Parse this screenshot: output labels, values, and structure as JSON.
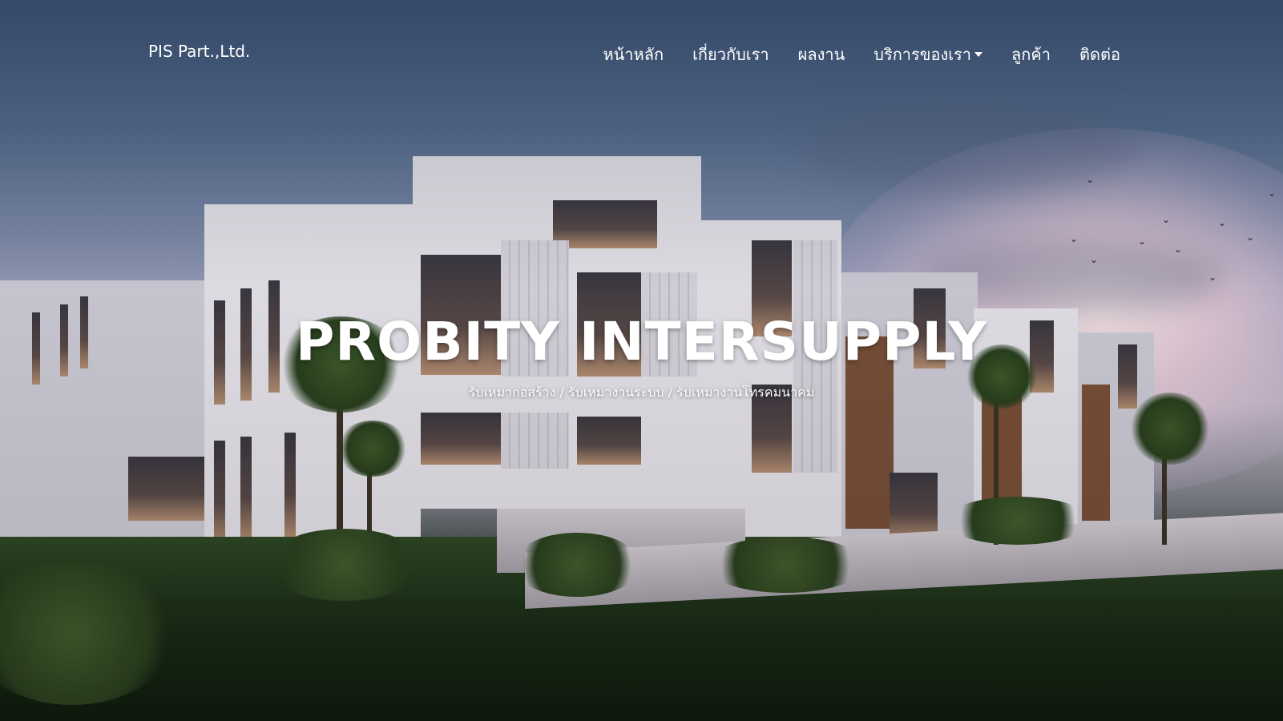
{
  "brand": "PIS Part.,Ltd.",
  "nav": {
    "items": [
      {
        "label": "หน้าหลัก"
      },
      {
        "label": "เกี่ยวกับเรา"
      },
      {
        "label": "ผลงาน"
      },
      {
        "label": "บริการของเรา"
      },
      {
        "label": "ลูกค้า"
      },
      {
        "label": "ติดต่อ"
      }
    ]
  },
  "hero": {
    "title": "PROBITY INTERSUPPLY",
    "subtitle": "รับเหมาก่อสร้าง / รับเหมางานระบบ / รับเหมางานโทรคมนาคม"
  },
  "icons": {
    "dropdown": "chevron-down-icon"
  }
}
